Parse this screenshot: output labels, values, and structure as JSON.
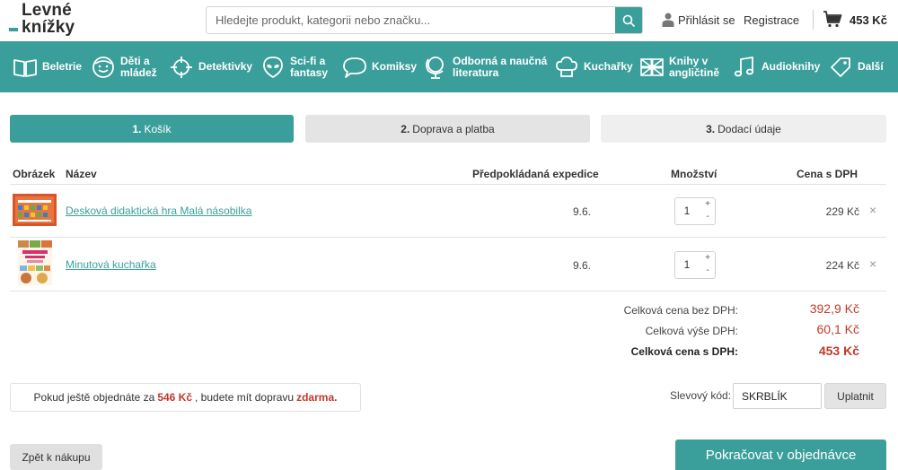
{
  "header": {
    "logo_line1": "Levné",
    "logo_line2": "knížky",
    "search_placeholder": "Hledejte produkt, kategorii nebo značku...",
    "login": "Přihlásit se",
    "register": "Registrace",
    "cart_total": "453 Kč",
    "icons": [
      "search-icon",
      "user-icon",
      "cart-icon"
    ]
  },
  "nav": [
    {
      "label": "Beletrie",
      "icon": "book-icon"
    },
    {
      "label": "Děti a\nmládež",
      "icon": "kid-face-icon"
    },
    {
      "label": "Detektivky",
      "icon": "crosshair-icon"
    },
    {
      "label": "Sci-fi a\nfantasy",
      "icon": "alien-icon"
    },
    {
      "label": "Komiksy",
      "icon": "speech-bubble-icon"
    },
    {
      "label": "Odborná a naučná\nliteratura",
      "icon": "globe-icon"
    },
    {
      "label": "Kuchařky",
      "icon": "chef-hat-icon"
    },
    {
      "label": "Knihy v\nangličtině",
      "icon": "uk-flag-icon"
    },
    {
      "label": "Audioknihy",
      "icon": "music-note-icon"
    },
    {
      "label": "Další",
      "icon": "tag-icon"
    }
  ],
  "steps": [
    {
      "num": "1.",
      "label": "Košík"
    },
    {
      "num": "2.",
      "label": "Doprava a platba"
    },
    {
      "num": "3.",
      "label": "Dodací údaje"
    }
  ],
  "table": {
    "headers": {
      "image": "Obrázek",
      "name": "Název",
      "expedition": "Předpokládaná expedice",
      "quantity": "Množství",
      "price": "Cena s DPH"
    },
    "rows": [
      {
        "name": "Desková didaktická hra Malá násobilka",
        "expedition": "9.6.",
        "quantity": "1",
        "price": "229 Kč"
      },
      {
        "name": "Minutová kuchařka",
        "expedition": "9.6.",
        "quantity": "1",
        "price": "224 Kč"
      }
    ],
    "plus": "+",
    "minus": "-",
    "remove": "×"
  },
  "summary": {
    "without_vat_label": "Celková cena bez DPH:",
    "without_vat": "392,9 Kč",
    "vat_label": "Celková výše DPH:",
    "vat": "60,1 Kč",
    "with_vat_label": "Celková cena s DPH:",
    "with_vat": "453 Kč"
  },
  "free_shipping": {
    "pre": "Pokud ještě objednáte za",
    "amount": "546 Kč",
    "mid": ", budete mít dopravu",
    "free": "zdarma."
  },
  "discount": {
    "label": "Slevový kód:",
    "value": "SKRBLÍK",
    "button": "Uplatnit"
  },
  "buttons": {
    "back": "Zpět k nákupu",
    "continue": "Pokračovat v objednávce"
  },
  "colors": {
    "accent": "#3a9f9a",
    "price_red": "#c0392b"
  }
}
